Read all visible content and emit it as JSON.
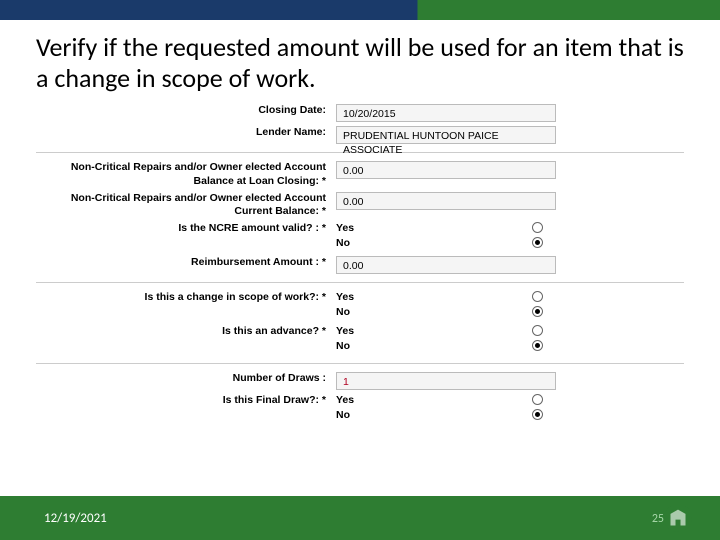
{
  "slide": {
    "title": "Verify if the requested amount will be used for an item that is a change in scope of work."
  },
  "fields": {
    "closing_date": {
      "label": "Closing Date:",
      "value": "10/20/2015"
    },
    "lender_name": {
      "label": "Lender Name:",
      "value": "PRUDENTIAL HUNTOON PAICE ASSOCIATE"
    },
    "ncre_balance_loan_closing": {
      "label": "Non-Critical Repairs and/or Owner elected Account Balance at Loan Closing: *",
      "value": "0.00"
    },
    "ncre_current_balance": {
      "label": "Non-Critical Repairs and/or Owner elected Account Current Balance: *",
      "value": "0.00"
    },
    "ncre_valid": {
      "label": "Is the NCRE amount valid? : *",
      "options": {
        "yes": "Yes",
        "no": "No"
      },
      "selected": "no"
    },
    "reimbursement_amount": {
      "label": "Reimbursement Amount : *",
      "value": "0.00"
    },
    "change_scope": {
      "label": "Is this a change in scope of work?: *",
      "options": {
        "yes": "Yes",
        "no": "No"
      },
      "selected": "no"
    },
    "is_advance": {
      "label": "Is this an advance? *",
      "options": {
        "yes": "Yes",
        "no": "No"
      },
      "selected": "no"
    },
    "number_of_draws": {
      "label": "Number of Draws :",
      "value": "1"
    },
    "is_final_draw": {
      "label": "Is this Final Draw?: *",
      "options": {
        "yes": "Yes",
        "no": "No"
      },
      "selected": "no"
    }
  },
  "footer": {
    "date": "12/19/2021",
    "page": "25"
  }
}
